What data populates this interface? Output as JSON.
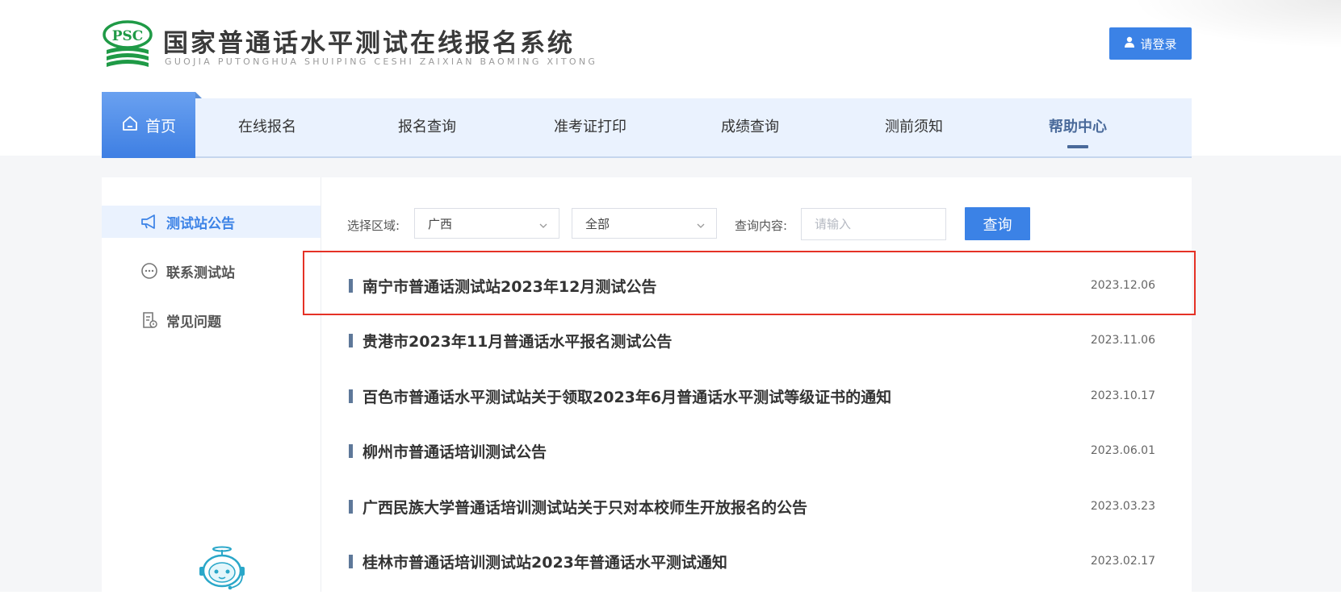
{
  "header": {
    "logo_badge": "PSC",
    "site_title": "国家普通话水平测试在线报名系统",
    "site_subtitle": "GUOJIA PUTONGHUA SHUIPING CESHI ZAIXIAN BAOMING XITONG",
    "login_label": "请登录",
    "login_icon": "user-icon"
  },
  "nav": {
    "items": [
      {
        "label": "首页",
        "icon": "home-icon"
      },
      {
        "label": "在线报名"
      },
      {
        "label": "报名查询"
      },
      {
        "label": "准考证打印"
      },
      {
        "label": "成绩查询"
      },
      {
        "label": "测前须知"
      },
      {
        "label": "帮助中心"
      }
    ],
    "active_index": 6
  },
  "sidebar": {
    "items": [
      {
        "label": "测试站公告",
        "icon": "megaphone-icon"
      },
      {
        "label": "联系测试站",
        "icon": "chat-bubble-icon"
      },
      {
        "label": "常见问题",
        "icon": "faq-document-icon"
      }
    ],
    "active_index": 0,
    "assistant_icon": "robot-assistant-icon"
  },
  "filters": {
    "region_label": "选择区域:",
    "region_value": "广西",
    "city_value": "全部",
    "query_label": "查询内容:",
    "query_placeholder": "请输入",
    "search_label": "查询"
  },
  "notices": [
    {
      "title": "南宁市普通话测试站2023年12月测试公告",
      "date": "2023.12.06"
    },
    {
      "title": "贵港市2023年11月普通话水平报名测试公告",
      "date": "2023.11.06"
    },
    {
      "title": "百色市普通话水平测试站关于领取2023年6月普通话水平测试等级证书的通知",
      "date": "2023.10.17"
    },
    {
      "title": "柳州市普通话培训测试公告",
      "date": "2023.06.01"
    },
    {
      "title": "广西民族大学普通话培训测试站关于只对本校师生开放报名的公告",
      "date": "2023.03.23"
    },
    {
      "title": "桂林市普通话培训测试站2023年普通话水平测试通知",
      "date": "2023.02.17"
    }
  ],
  "colors": {
    "accent": "#3b82e6",
    "nav_bg": "#eaf2fe",
    "highlight": "#e53226",
    "logo_green": "#1f9a46"
  }
}
